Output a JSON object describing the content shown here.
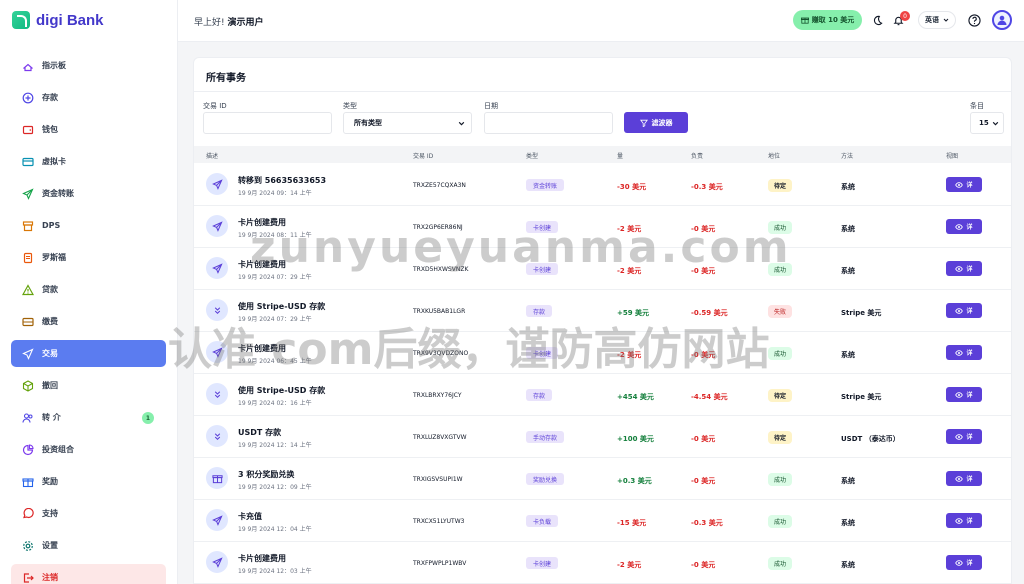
{
  "app": {
    "logo_text": "digi Bank"
  },
  "sidebar": {
    "items": [
      {
        "label": "指示板",
        "icon": "dashboard-icon"
      },
      {
        "label": "存款",
        "icon": "plus-circle-icon"
      },
      {
        "label": "钱包",
        "icon": "wallet-icon"
      },
      {
        "label": "虚拟卡",
        "icon": "card-icon"
      },
      {
        "label": "资金转账",
        "icon": "send-icon"
      },
      {
        "label": "DPS",
        "icon": "box-icon"
      },
      {
        "label": "罗斯福",
        "icon": "document-icon"
      },
      {
        "label": "贷款",
        "icon": "warning-icon"
      },
      {
        "label": "缴费",
        "icon": "bill-icon"
      },
      {
        "label": "交易",
        "icon": "transaction-icon"
      },
      {
        "label": "撤回",
        "icon": "cube-icon"
      },
      {
        "label": "转 介",
        "icon": "users-icon",
        "badge": "1"
      },
      {
        "label": "投资组合",
        "icon": "pie-icon"
      },
      {
        "label": "奖励",
        "icon": "gift-icon"
      },
      {
        "label": "支持",
        "icon": "chat-icon"
      },
      {
        "label": "设置",
        "icon": "gear-icon"
      },
      {
        "label": "注销",
        "icon": "logout-icon"
      }
    ],
    "active_index": 9
  },
  "topbar": {
    "greeting_prefix": "早上好!",
    "user_name": "演示用户",
    "earn_label": "赚取 10 美元",
    "notification_count": "0",
    "language": "英语"
  },
  "card": {
    "title": "所有事务",
    "filters": {
      "txid_label": "交易 ID",
      "txid_value": "",
      "type_label": "类型",
      "type_value": "所有类型",
      "date_label": "日期",
      "date_value": "",
      "filter_button": "滤波器",
      "entries_label": "条目",
      "entries_value": "15"
    },
    "columns": [
      "描述",
      "交易 ID",
      "类型",
      "量",
      "负责",
      "地位",
      "方法",
      "视图"
    ],
    "view_label": "详",
    "rows": [
      {
        "icon": "send-icon",
        "desc": "转移到 56635633653",
        "date": "19 9月 2024 09：14 上午",
        "txid": "TRXZE57CQXA3N",
        "type": "资金转账",
        "amount": "-30 美元",
        "amount_sign": "neg",
        "fee": "-0.3 美元",
        "status": "待定",
        "status_kind": "pending",
        "method": "系统"
      },
      {
        "icon": "send-icon",
        "desc": "卡片创建费用",
        "date": "19 9月 2024 08：11 上午",
        "txid": "TRX2GP6ER86NJ",
        "type": "卡创建",
        "amount": "-2 美元",
        "amount_sign": "neg",
        "fee": "-0 美元",
        "status": "成功",
        "status_kind": "success",
        "method": "系统"
      },
      {
        "icon": "send-icon",
        "desc": "卡片创建费用",
        "date": "19 9月 2024 07：29 上午",
        "txid": "TRXD5HXWSVNZK",
        "type": "卡创建",
        "amount": "-2 美元",
        "amount_sign": "neg",
        "fee": "-0 美元",
        "status": "成功",
        "status_kind": "success",
        "method": "系统"
      },
      {
        "icon": "chevrons-down-icon",
        "desc": "使用 Stripe-USD 存款",
        "date": "19 9月 2024 07：29 上午",
        "txid": "TRXKU5BAB1LGR",
        "type": "存款",
        "amount": "+59 美元",
        "amount_sign": "pos",
        "fee": "-0.59 美元",
        "status": "失败",
        "status_kind": "failed",
        "method": "Stripe 美元"
      },
      {
        "icon": "send-icon",
        "desc": "卡片创建费用",
        "date": "19 9月 2024 06：45 上午",
        "txid": "TRX9V3QVDZONO",
        "type": "卡创建",
        "amount": "-2 美元",
        "amount_sign": "neg",
        "fee": "-0 美元",
        "status": "成功",
        "status_kind": "success",
        "method": "系统"
      },
      {
        "icon": "chevrons-down-icon",
        "desc": "使用 Stripe-USD 存款",
        "date": "19 9月 2024 02：16 上午",
        "txid": "TRXLBRXY76JCY",
        "type": "存款",
        "amount": "+454 美元",
        "amount_sign": "pos",
        "fee": "-4.54 美元",
        "status": "待定",
        "status_kind": "pending",
        "method": "Stripe 美元"
      },
      {
        "icon": "chevrons-down-icon",
        "desc": "USDT 存款",
        "date": "19 9月 2024 12：14 上午",
        "txid": "TRXLUZ8VXGTVW",
        "type": "手动存款",
        "amount": "+100 美元",
        "amount_sign": "pos",
        "fee": "-0 美元",
        "status": "待定",
        "status_kind": "pending",
        "method": "USDT （泰达币）"
      },
      {
        "icon": "gift-icon",
        "desc": "3 积分奖励兑换",
        "date": "19 9月 2024 12：09 上午",
        "txid": "TRXIGSVSUPI1W",
        "type": "奖励兑换",
        "amount": "+0.3 美元",
        "amount_sign": "pos",
        "fee": "-0 美元",
        "status": "成功",
        "status_kind": "success",
        "method": "系统"
      },
      {
        "icon": "send-icon",
        "desc": "卡充值",
        "date": "19 9月 2024 12：04 上午",
        "txid": "TRXCX51LYUTW3",
        "type": "卡负载",
        "amount": "-15 美元",
        "amount_sign": "neg",
        "fee": "-0.3 美元",
        "status": "成功",
        "status_kind": "success",
        "method": "系统"
      },
      {
        "icon": "send-icon",
        "desc": "卡片创建费用",
        "date": "19 9月 2024 12：03 上午",
        "txid": "TRXFPWPLP1WBV",
        "type": "卡创建",
        "amount": "-2 美元",
        "amount_sign": "neg",
        "fee": "-0 美元",
        "status": "成功",
        "status_kind": "success",
        "method": "系统"
      }
    ]
  },
  "watermark": {
    "line1": "zunyueyuanma.com",
    "line2": "认准 com后缀，谨防高仿网站"
  },
  "colors": {
    "primary": "#5b3fd8",
    "active_nav": "#5b7cf0",
    "success_bg": "#dcfce7",
    "pending_bg": "#fef3c7",
    "failed_bg": "#fee2e2"
  }
}
